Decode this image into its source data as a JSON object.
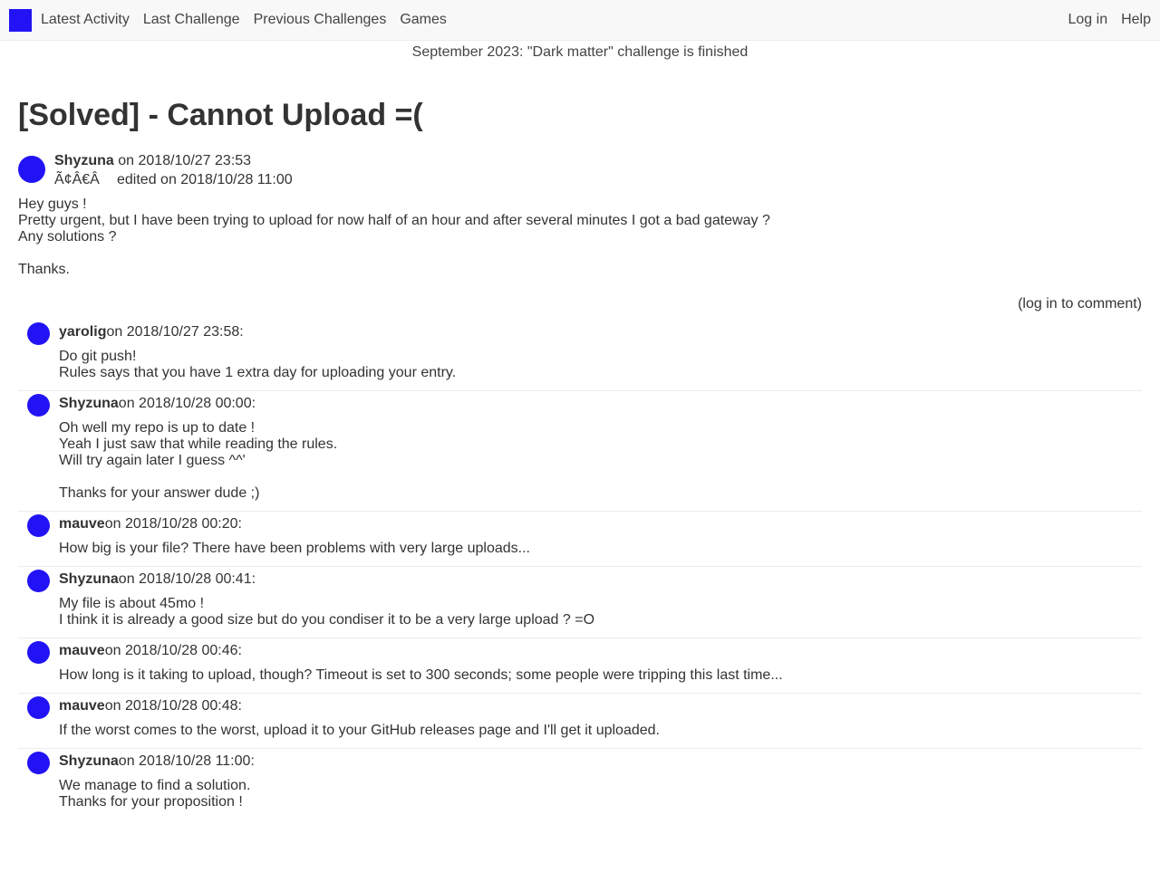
{
  "nav": {
    "logo_color": "#2113f5",
    "left": [
      "Latest Activity",
      "Last Challenge",
      "Previous Challenges",
      "Games"
    ],
    "right": [
      "Log in",
      "Help"
    ]
  },
  "banner": "September 2023: \"Dark matter\" challenge is finished",
  "thread": {
    "title": "[Solved] - Cannot Upload =(",
    "author": "Shyzuna",
    "posted": "on 2018/10/27 23:53",
    "mangled_chars": "Ã¢Â€Â",
    "edited": "edited on 2018/10/28 11:00",
    "body": [
      "Hey guys !",
      "Pretty urgent, but I have been trying to upload for now half of an hour and after several minutes I got a bad gateway ?",
      "Any solutions ?",
      "",
      "Thanks."
    ],
    "login_to_comment": "(log in to comment)"
  },
  "comments": [
    {
      "author": "yarolig",
      "when": "on 2018/10/27 23:58:",
      "lines": [
        "Do git push!",
        "Rules says that you have 1 extra day for uploading your entry."
      ]
    },
    {
      "author": "Shyzuna",
      "when": "on 2018/10/28 00:00:",
      "lines": [
        "Oh well my repo is up to date !",
        "Yeah I just saw that while reading the rules.",
        "Will try again later I guess ^^'",
        "",
        "Thanks for your answer dude ;)"
      ]
    },
    {
      "author": "mauve",
      "when": "on 2018/10/28 00:20:",
      "lines": [
        "How big is your file? There have been problems with very large uploads..."
      ]
    },
    {
      "author": "Shyzuna",
      "when": "on 2018/10/28 00:41:",
      "lines": [
        "My file is about 45mo !",
        "I think it is already a good size but do you condiser it to be a very large upload ? =O"
      ]
    },
    {
      "author": "mauve",
      "when": "on 2018/10/28 00:46:",
      "lines": [
        "How long is it taking to upload, though? Timeout is set to 300 seconds; some people were tripping this last time..."
      ]
    },
    {
      "author": "mauve",
      "when": "on 2018/10/28 00:48:",
      "lines": [
        "If the worst comes to the worst, upload it to your GitHub releases page and I'll get it uploaded."
      ]
    },
    {
      "author": "Shyzuna",
      "when": "on 2018/10/28 11:00:",
      "lines": [
        "We manage to find a solution.",
        "Thanks for your proposition !"
      ]
    }
  ]
}
